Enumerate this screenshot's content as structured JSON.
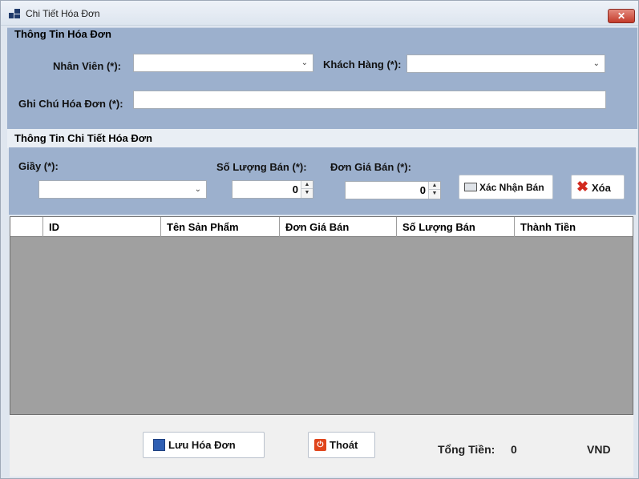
{
  "window": {
    "title": "Chi Tiết Hóa Đơn",
    "close_label": "✕",
    "accent_color": "#9cb0cd",
    "icons": [
      "app-icon",
      "close-icon"
    ]
  },
  "invoice_info": {
    "group_title": "Thông Tin Hóa Đơn",
    "employee_label": "Nhân Viên (*):",
    "employee_value": "",
    "customer_label": "Khách Hàng (*):",
    "customer_value": "",
    "note_label": "Ghi Chú Hóa Đơn (*):",
    "note_value": ""
  },
  "detail_info": {
    "group_title": "Thông Tin Chi Tiết Hóa Đơn",
    "shoe_label": "Giầy (*):",
    "shoe_value": "",
    "quantity_label": "Số Lượng Bán (*):",
    "quantity_value": "0",
    "price_label": "Đơn Giá Bán (*):",
    "price_value": "0",
    "confirm_button": "Xác Nhận Bán",
    "delete_button": "Xóa",
    "chevron_icon": "chevron-down-icon"
  },
  "grid": {
    "columns": [
      "",
      "ID",
      "Tên Sản Phẩm",
      "Đơn Giá Bán",
      "Số Lượng Bán",
      "Thành Tiền"
    ],
    "rows": []
  },
  "footer": {
    "save_button": "Lưu Hóa Đơn",
    "exit_button": "Thoát",
    "total_label": "Tổng Tiền:",
    "total_value": "0",
    "currency": "VND"
  }
}
